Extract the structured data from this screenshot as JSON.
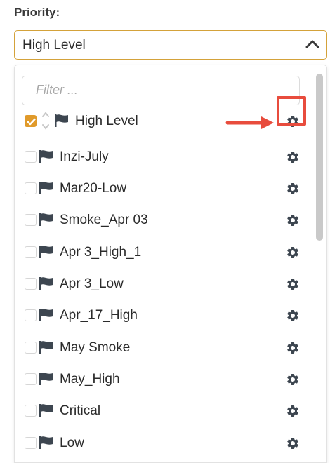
{
  "field": {
    "label": "Priority:",
    "selected_value": "High Level"
  },
  "dropdown": {
    "filter_placeholder": "Filter ...",
    "items": [
      {
        "label": "High Level",
        "checked": true
      },
      {
        "label": "Inzi-July",
        "checked": false
      },
      {
        "label": "Mar20-Low",
        "checked": false
      },
      {
        "label": "Smoke_Apr 03",
        "checked": false
      },
      {
        "label": "Apr 3_High_1",
        "checked": false
      },
      {
        "label": "Apr 3_Low",
        "checked": false
      },
      {
        "label": "Apr_17_High",
        "checked": false
      },
      {
        "label": "May Smoke",
        "checked": false
      },
      {
        "label": "May_High",
        "checked": false
      },
      {
        "label": "Critical",
        "checked": false
      },
      {
        "label": "Low",
        "checked": false
      }
    ]
  },
  "colors": {
    "accent": "#e09a2a",
    "highlight": "#e84c3d",
    "icon": "#3d4650"
  }
}
